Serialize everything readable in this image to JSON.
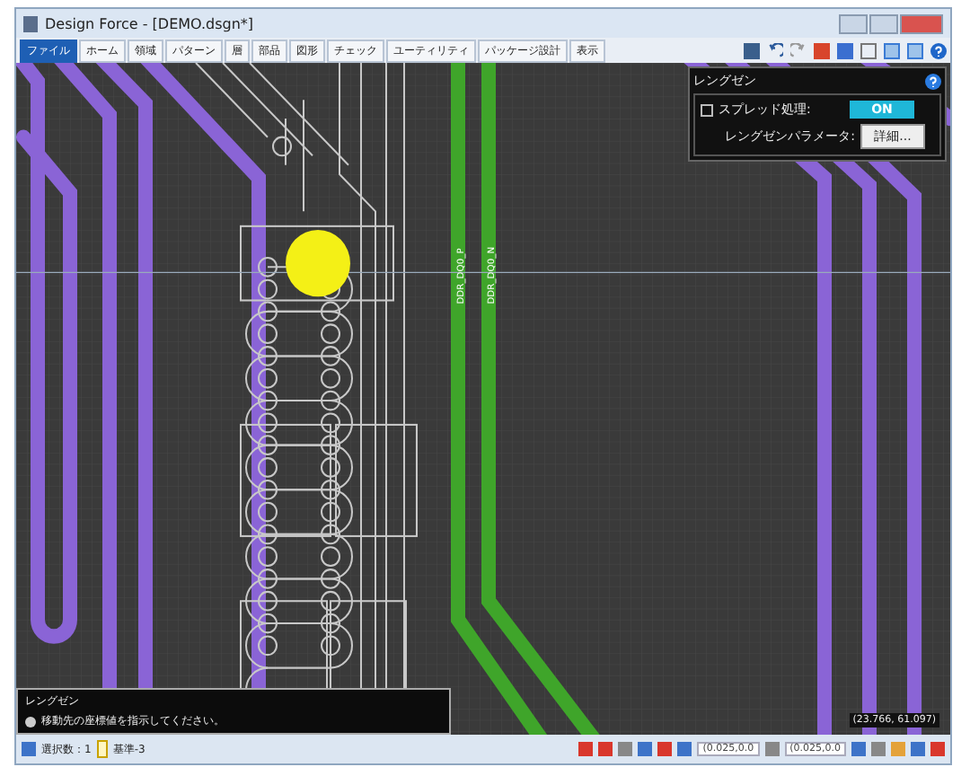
{
  "window": {
    "title": "Design Force - [DEMO.dsgn*]"
  },
  "menu_tabs": [
    {
      "label": "ファイル",
      "selected": true
    },
    {
      "label": "ホーム",
      "selected": false
    },
    {
      "label": "領域",
      "selected": false
    },
    {
      "label": "パターン",
      "selected": false
    },
    {
      "label": "層",
      "selected": false
    },
    {
      "label": "部品",
      "selected": false
    },
    {
      "label": "図形",
      "selected": false
    },
    {
      "label": "チェック",
      "selected": false
    },
    {
      "label": "ユーティリティ",
      "selected": false
    },
    {
      "label": "パッケージ設計",
      "selected": false
    },
    {
      "label": "表示",
      "selected": false
    }
  ],
  "canvas": {
    "trace_labels": [
      "DDR_DQ0_P",
      "DDR_DQ0_N"
    ]
  },
  "length_panel": {
    "title": "レングゼン",
    "spread_label": "スプレッド処理:",
    "spread": {
      "on": true,
      "label": "ON"
    },
    "param_label": "レングゼンパラメータ:",
    "param_button": "詳細..."
  },
  "message": {
    "title": "レングゼン",
    "text": "移動先の座標値を指示してください。"
  },
  "status_bar": {
    "selection": "選択数：1",
    "layer": "基準-3",
    "offset_x": "(0.025,0.0",
    "offset_y": "(0.025,0.0",
    "coordinates": "(23.766, 61.097)"
  }
}
